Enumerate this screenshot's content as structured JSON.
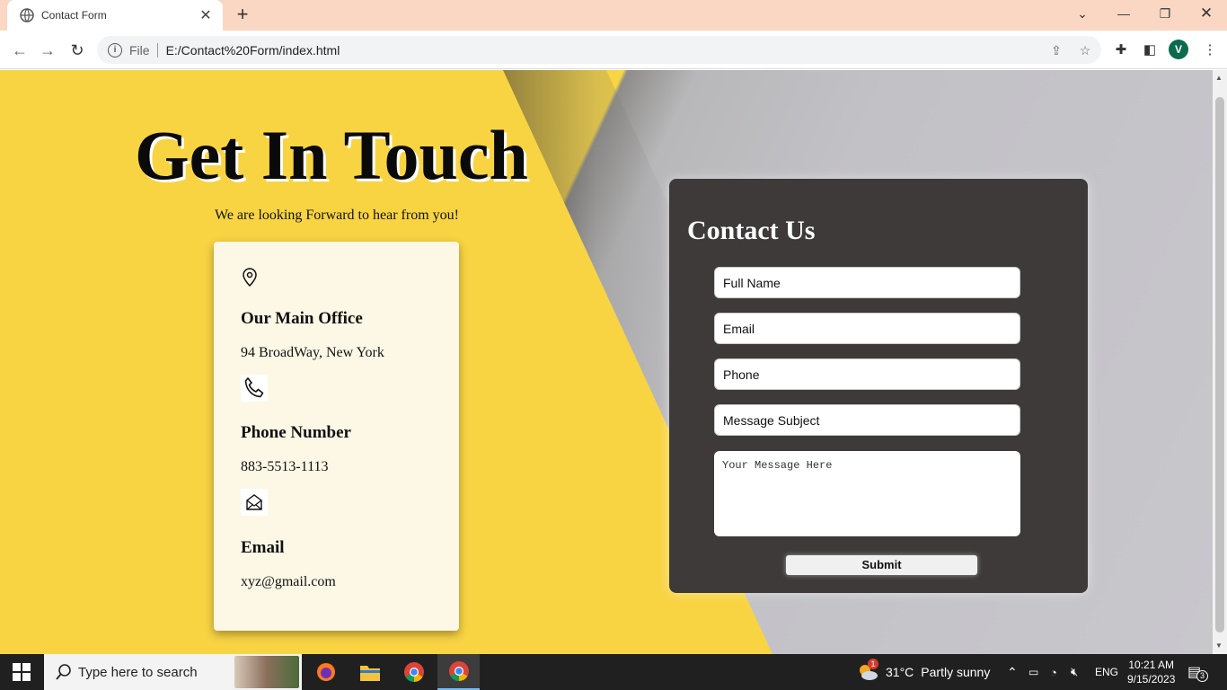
{
  "browser": {
    "tab_title": "Contact Form",
    "omnibox": {
      "scheme_label": "File",
      "url": "E:/Contact%20Form/index.html"
    },
    "profile_initial": "V"
  },
  "page": {
    "heading": "Get In Touch",
    "subheading": "We are looking Forward to hear from you!",
    "info_card": {
      "office_title": "Our Main Office",
      "office_value": "94 BroadWay, New York",
      "phone_title": "Phone Number",
      "phone_value": "883-5513-1113",
      "email_title": "Email",
      "email_value": "xyz@gmail.com"
    },
    "form": {
      "title": "Contact Us",
      "full_name_placeholder": "Full Name",
      "email_placeholder": "Email",
      "phone_placeholder": "Phone",
      "subject_placeholder": "Message Subject",
      "message_placeholder": "Your Message Here",
      "submit_label": "Submit"
    },
    "colors": {
      "yellow": "#f8d443",
      "form_bg": "#3e3a3a",
      "card_bg": "#fdf8e6"
    }
  },
  "taskbar": {
    "search_placeholder": "Type here to search",
    "weather": {
      "temp": "31°C",
      "condition": "Partly sunny",
      "badge": "1"
    },
    "language": "ENG",
    "time": "10:21 AM",
    "date": "9/15/2023",
    "notifications_count": "3"
  }
}
